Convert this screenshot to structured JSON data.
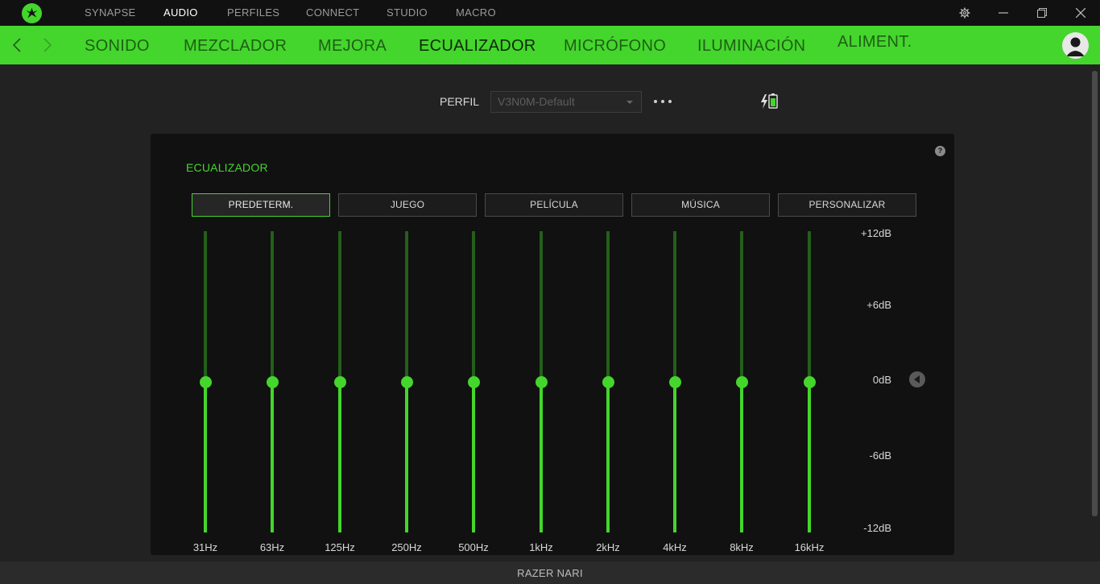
{
  "topnav": {
    "items": [
      {
        "label": "SYNAPSE",
        "active": false
      },
      {
        "label": "AUDIO",
        "active": true
      },
      {
        "label": "PERFILES",
        "active": false
      },
      {
        "label": "CONNECT",
        "active": false
      },
      {
        "label": "STUDIO",
        "active": false
      },
      {
        "label": "MACRO",
        "active": false
      }
    ]
  },
  "subnav": {
    "tabs": [
      {
        "label": "SONIDO",
        "active": false
      },
      {
        "label": "MEZCLADOR",
        "active": false
      },
      {
        "label": "MEJORA",
        "active": false
      },
      {
        "label": "ECUALIZADOR",
        "active": true
      },
      {
        "label": "MICRÓFONO",
        "active": false
      },
      {
        "label": "ILUMINACIÓN",
        "active": false
      },
      {
        "label": "ALIMENT.",
        "active": false
      }
    ]
  },
  "profile": {
    "label": "PERFIL",
    "selected": "V3N0M-Default"
  },
  "equalizer": {
    "title": "ECUALIZADOR",
    "help": "?",
    "presets": [
      {
        "label": "PREDETERM.",
        "active": true
      },
      {
        "label": "JUEGO",
        "active": false
      },
      {
        "label": "PELÍCULA",
        "active": false
      },
      {
        "label": "MÚSICA",
        "active": false
      },
      {
        "label": "PERSONALIZAR",
        "active": false
      }
    ],
    "bands": [
      {
        "freq": "31Hz",
        "gain_db": 0
      },
      {
        "freq": "63Hz",
        "gain_db": 0
      },
      {
        "freq": "125Hz",
        "gain_db": 0
      },
      {
        "freq": "250Hz",
        "gain_db": 0
      },
      {
        "freq": "500Hz",
        "gain_db": 0
      },
      {
        "freq": "1kHz",
        "gain_db": 0
      },
      {
        "freq": "2kHz",
        "gain_db": 0
      },
      {
        "freq": "4kHz",
        "gain_db": 0
      },
      {
        "freq": "8kHz",
        "gain_db": 0
      },
      {
        "freq": "16kHz",
        "gain_db": 0
      }
    ],
    "range_db": [
      -12,
      12
    ],
    "db_labels": [
      "+12dB",
      "+6dB",
      "0dB",
      "-6dB",
      "-12dB"
    ]
  },
  "footer": {
    "device": "RAZER NARI"
  },
  "colors": {
    "accent": "#44d62c",
    "background": "#222222",
    "panel": "#111111",
    "titlebar": "#111111"
  }
}
